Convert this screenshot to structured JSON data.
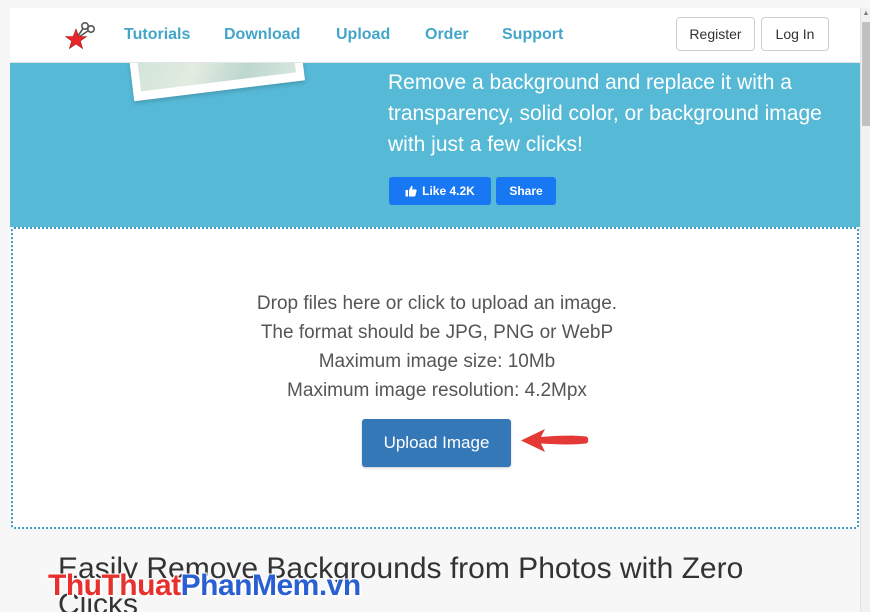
{
  "nav": {
    "links": [
      "Tutorials",
      "Download",
      "Upload",
      "Order",
      "Support"
    ],
    "register_label": "Register",
    "login_label": "Log In"
  },
  "hero": {
    "description": "Remove a background and replace it with a transparency, solid color, or background image with just a few clicks!",
    "like_label": "Like 4.2K",
    "share_label": "Share"
  },
  "dropzone": {
    "lines": [
      "Drop files here or click to upload an image.",
      "The format should be JPG, PNG or WebP",
      "Maximum image size: 10Mb",
      "Maximum image resolution: 4.2Mpx"
    ],
    "upload_label": "Upload Image"
  },
  "section": {
    "title": "Easily Remove Backgrounds from Photos with Zero Clicks"
  },
  "watermark": {
    "part1": "Thu",
    "part2": "Thuat",
    "part3": "PhanMem",
    "part4": ".vn"
  },
  "colors": {
    "accent": "#56b9d6",
    "nav_link": "#43a6c8",
    "upload_button": "#3578b8",
    "facebook": "#1877f2",
    "arrow": "#e53935"
  }
}
